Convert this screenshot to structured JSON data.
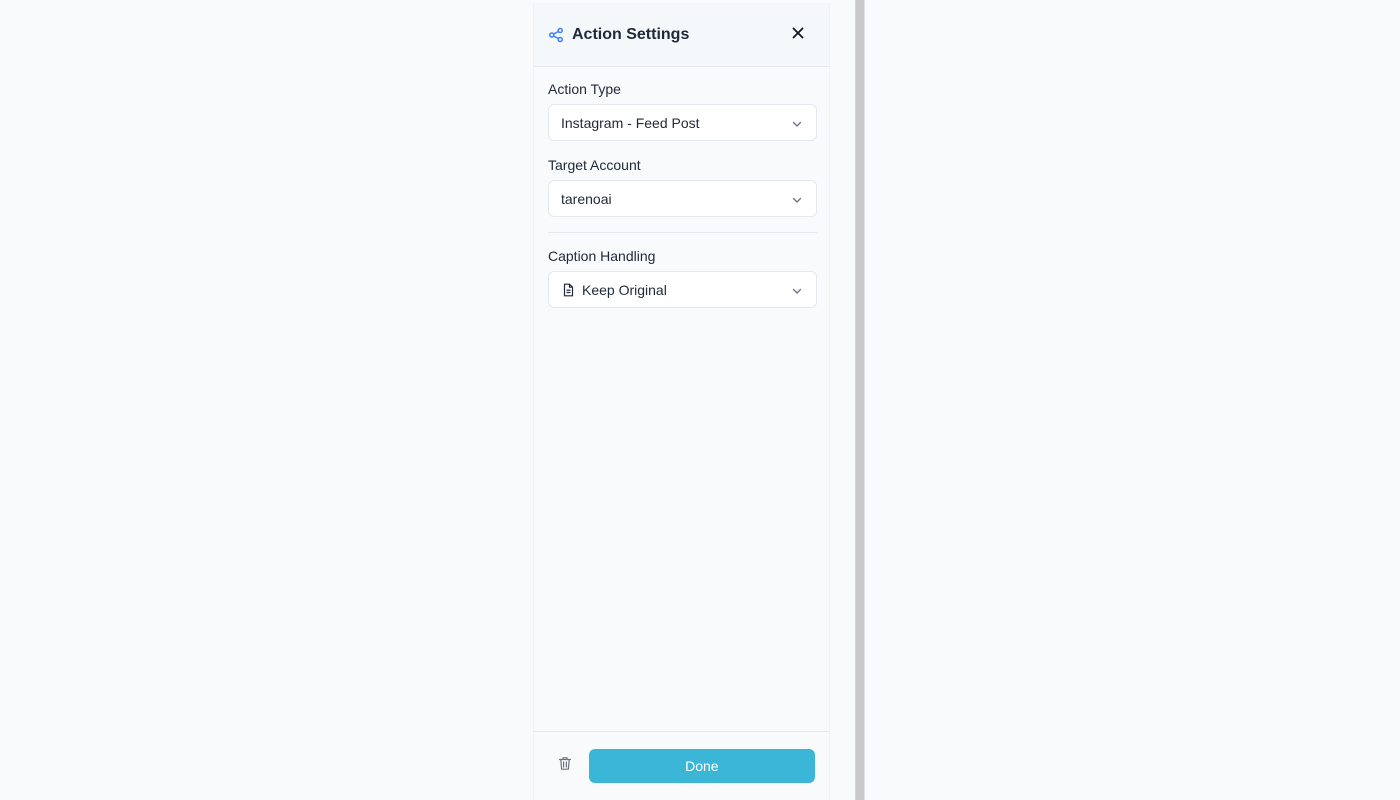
{
  "panel": {
    "title": "Action Settings",
    "header_icon": "share-nodes-icon",
    "close_icon": "close-icon",
    "fields": {
      "action_type": {
        "label": "Action Type",
        "value": "Instagram - Feed Post"
      },
      "target_account": {
        "label": "Target Account",
        "value": "tarenoai"
      },
      "caption_handling": {
        "label": "Caption Handling",
        "value": "Keep Original",
        "icon": "document-icon"
      }
    },
    "footer": {
      "delete_icon": "trash-icon",
      "done_label": "Done"
    }
  },
  "colors": {
    "accent": "#3bb6d6",
    "icon_blue": "#3b82f6",
    "page_bg": "#f8fafc",
    "border": "#e5e7eb"
  }
}
